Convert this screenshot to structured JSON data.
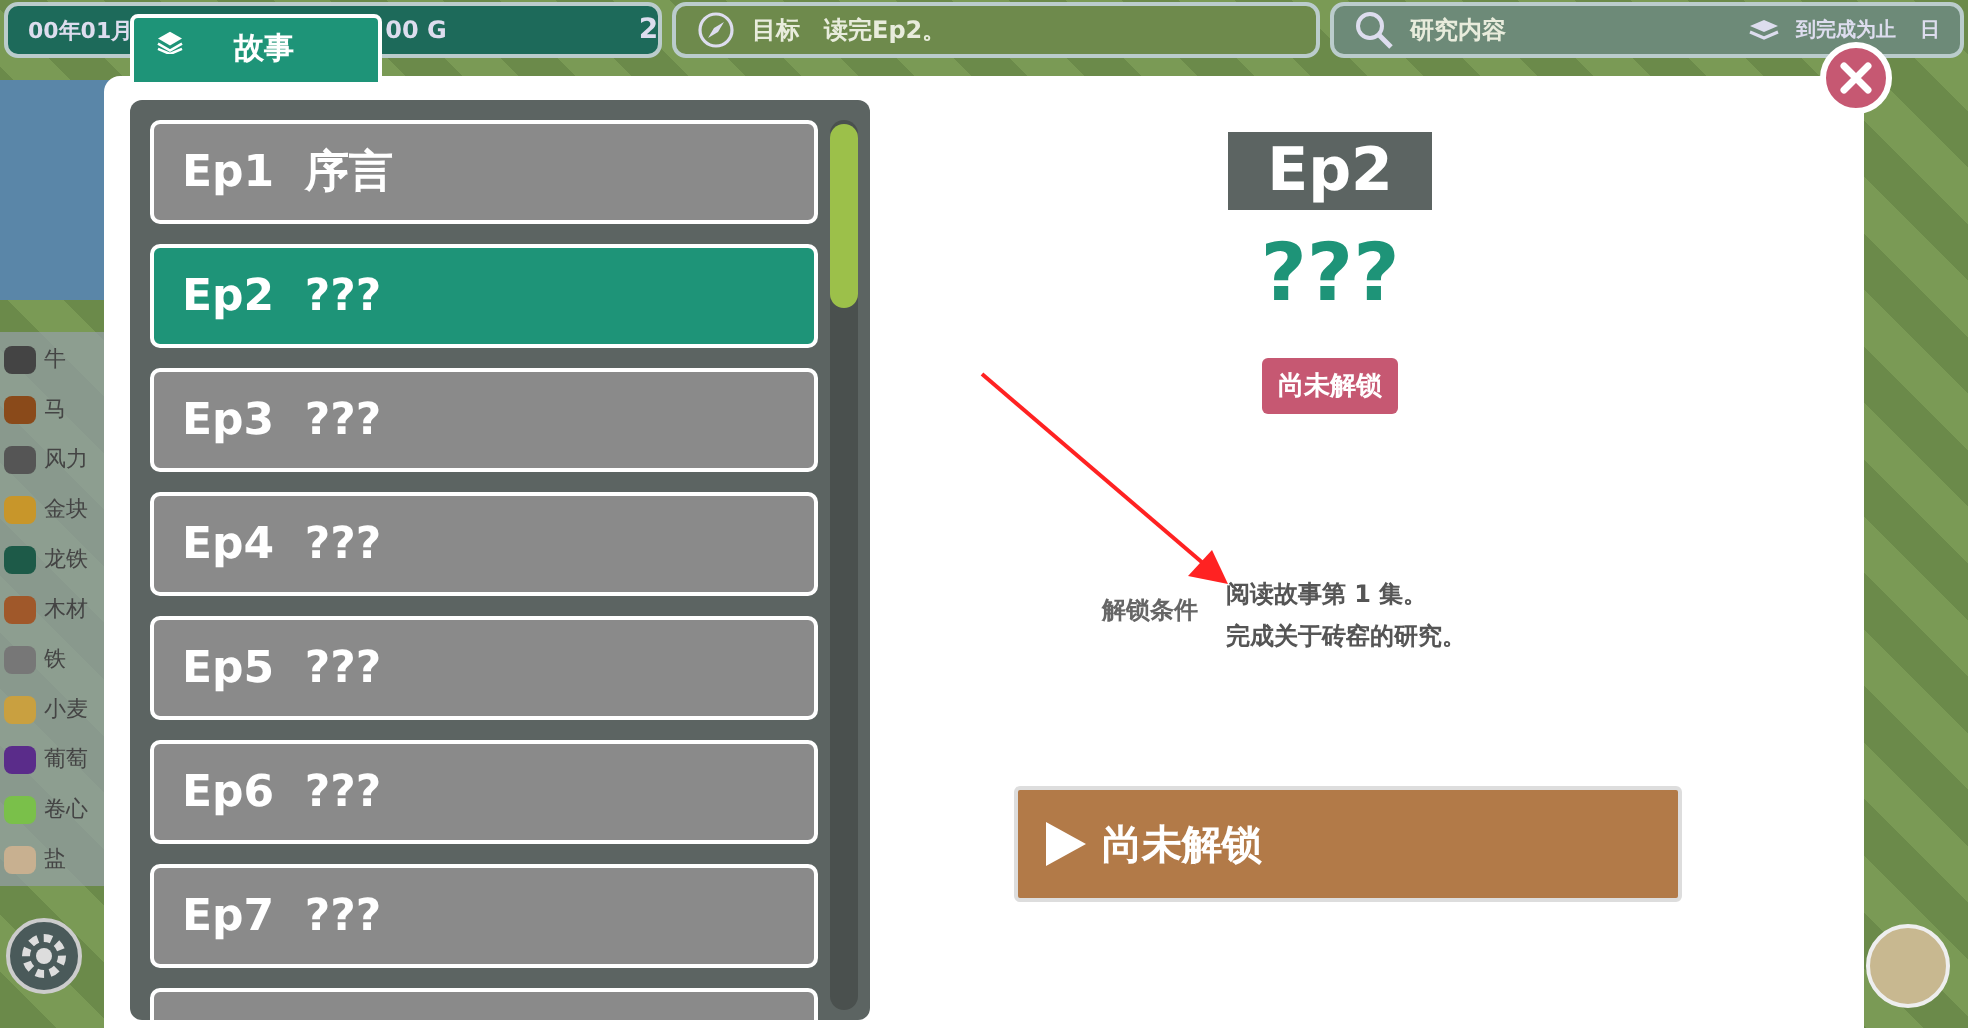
{
  "top_bar": {
    "date": "00年01月",
    "money": "00 G",
    "population": "2",
    "goal_label": "目标",
    "goal": "读完Ep2。",
    "research_label": "研究内容",
    "research_mode": "到完成为止",
    "edge_text": "日"
  },
  "resources": [
    {
      "name": "牛"
    },
    {
      "name": "马"
    },
    {
      "name": "风力"
    },
    {
      "name": "金块"
    },
    {
      "name": "龙铁"
    },
    {
      "name": "木材"
    },
    {
      "name": "铁"
    },
    {
      "name": "小麦"
    },
    {
      "name": "葡萄"
    },
    {
      "name": "卷心"
    },
    {
      "name": "盐"
    }
  ],
  "story_tab": {
    "label": "故事"
  },
  "episodes": [
    {
      "number": "Ep1",
      "title": "序言",
      "selected": false
    },
    {
      "number": "Ep2",
      "title": "???",
      "selected": true
    },
    {
      "number": "Ep3",
      "title": "???",
      "selected": false
    },
    {
      "number": "Ep4",
      "title": "???",
      "selected": false
    },
    {
      "number": "Ep5",
      "title": "???",
      "selected": false
    },
    {
      "number": "Ep6",
      "title": "???",
      "selected": false
    },
    {
      "number": "Ep7",
      "title": "???",
      "selected": false
    }
  ],
  "detail": {
    "episode": "Ep2",
    "title": "???",
    "status": "尚未解锁",
    "condition_label": "解锁条件",
    "conditions": [
      "阅读故事第 1 集。",
      "完成关于砖窑的研究。"
    ],
    "action": "尚未解锁"
  }
}
